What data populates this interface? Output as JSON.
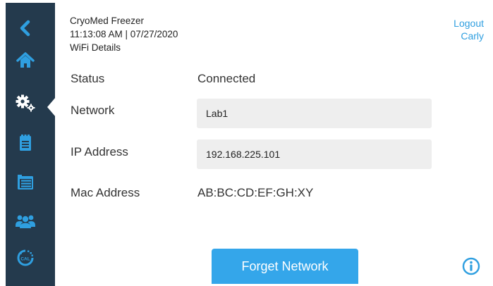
{
  "header": {
    "device_name": "CryoMed Freezer",
    "datetime": "11:13:08 AM | 07/27/2020",
    "page_title": "WiFi Details"
  },
  "user": {
    "logout_label": "Logout",
    "username": "Carly"
  },
  "sidebar": {
    "items": [
      {
        "icon": "back-icon"
      },
      {
        "icon": "home-icon"
      },
      {
        "icon": "settings-icon",
        "active": true
      },
      {
        "icon": "clipboard-icon"
      },
      {
        "icon": "reports-icon"
      },
      {
        "icon": "users-icon"
      },
      {
        "icon": "calibration-icon",
        "label": "CAL"
      }
    ]
  },
  "wifi": {
    "status_label": "Status",
    "status_value": "Connected",
    "network_label": "Network",
    "network_value": "Lab1",
    "ip_label": "IP Address",
    "ip_value": "192.168.225.101",
    "mac_label": "Mac Address",
    "mac_value": "AB:BC:CD:EF:GH:XY"
  },
  "actions": {
    "forget_label": "Forget Network"
  },
  "colors": {
    "sidebar_bg": "#243a4d",
    "icon_blue": "#2f9fe0",
    "button_blue": "#34a6ea",
    "field_bg": "#eeeeee"
  }
}
